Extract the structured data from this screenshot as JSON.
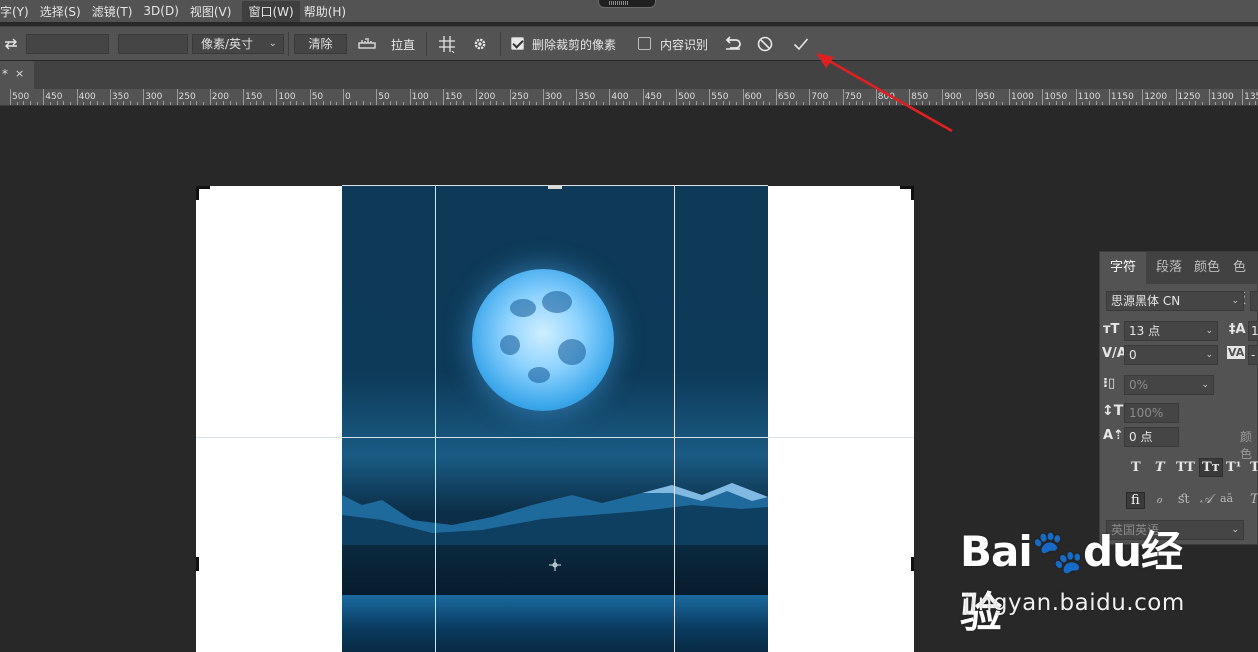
{
  "menu": {
    "items": [
      "字(Y)",
      "选择(S)",
      "滤镜(T)",
      "3D(D)",
      "视图(V)",
      "窗口(W)",
      "帮助(H)"
    ],
    "active_index": 5
  },
  "options_bar": {
    "unit_select": "像素/英寸",
    "clear_label": "清除",
    "straighten_label": "拉直",
    "delete_cropped_label": "删除裁剪的像素",
    "delete_cropped_checked": true,
    "content_aware_label": "内容识别",
    "content_aware_checked": false,
    "icons": [
      "swap-icon",
      "straighten-icon",
      "grid-overlay-icon",
      "gear-icon",
      "reset-icon",
      "cancel-icon",
      "commit-checkmark-icon"
    ]
  },
  "tab": {
    "title": "*",
    "close": "×"
  },
  "ruler": {
    "labels": [
      "500",
      "450",
      "400",
      "350",
      "300",
      "250",
      "200",
      "150",
      "100",
      "50",
      "0",
      "50",
      "100",
      "150",
      "200",
      "250",
      "300",
      "350",
      "400",
      "450",
      "500",
      "550",
      "600",
      "650",
      "700",
      "750",
      "800",
      "850",
      "900",
      "950",
      "1000",
      "1050",
      "1100",
      "1150",
      "1200",
      "1250",
      "1300",
      "135"
    ]
  },
  "character_panel": {
    "tabs": [
      "字符",
      "段落",
      "颜色",
      "色板"
    ],
    "active_tab": 0,
    "font_family": "思源黑体 CN",
    "font_size": "13 点",
    "leading_partial": "1",
    "kerning": "0",
    "tracking_partial": "-",
    "tsume": "0%",
    "vertical_scale": "100%",
    "baseline_shift": "0 点",
    "color_label_partial": "颜色",
    "language": "英国英语",
    "style_buttons": [
      "T",
      "T",
      "TT",
      "Tт",
      "T¹",
      "T"
    ],
    "opentype_buttons": [
      "ﬁ",
      "ℴ",
      "ﬆ",
      "𝒜",
      "aā",
      "T"
    ]
  },
  "watermark": {
    "main": "Bai🐾du经验",
    "sub": "jingyan.baidu.com"
  },
  "colors": {
    "ui_dark": "#282828",
    "ui_panel": "#535353",
    "annotation_arrow": "#e02020"
  }
}
